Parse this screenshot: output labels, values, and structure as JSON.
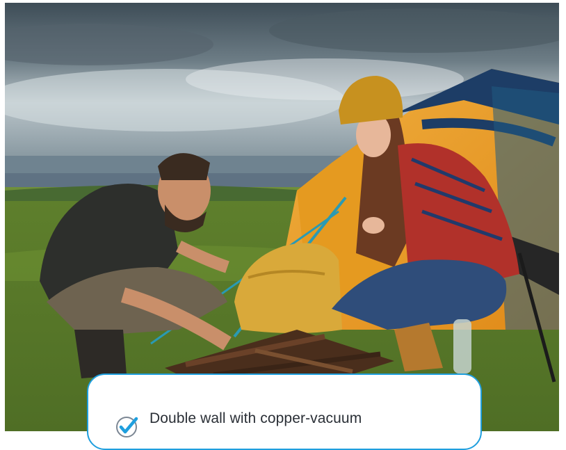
{
  "photo": {
    "subject": "two-campers-building-campfire-by-tent"
  },
  "feature_card": {
    "icon": "check-circle-icon",
    "accent_color": "#1f9fde",
    "text": "Double wall with copper-vacuum"
  }
}
